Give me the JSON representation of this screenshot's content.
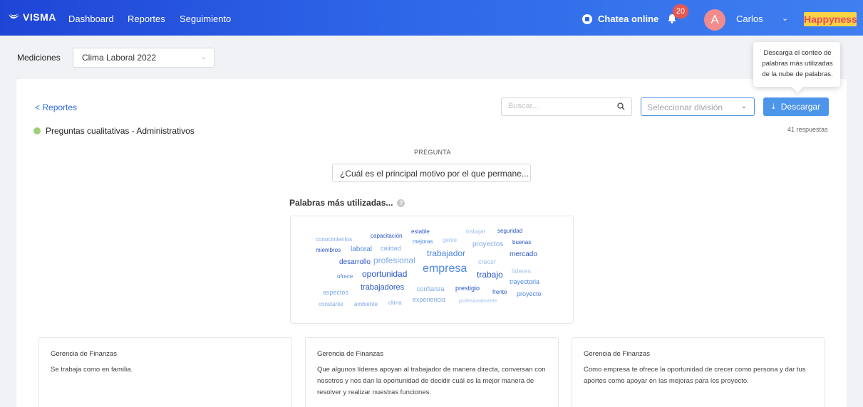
{
  "header": {
    "logo": "VISMA",
    "nav": [
      "Dashboard",
      "Reportes",
      "Seguimiento"
    ],
    "chat_label": "Chatea online",
    "notification_count": "20",
    "avatar_initial": "A",
    "username": "Carlos",
    "brand": "Happyness"
  },
  "mediciones": {
    "label": "Mediciones",
    "selected": "Clima Laboral 2022"
  },
  "toolbar": {
    "back_label": "Reportes",
    "search_placeholder": "Buscar...",
    "division_placeholder": "Seleccionar división",
    "download_label": "Descargar",
    "tooltip": "Descarga el conteo de palabras más utilizadas de la nube de palabras."
  },
  "section": {
    "title": "Preguntas cualitativas - Administrativos",
    "responses": "41 respuestas",
    "pregunta_label": "PREGUNTA",
    "pregunta_selected": "¿Cuál es el principal motivo por el que permane...",
    "palabras_title": "Palabras más utilizadas...",
    "help_icon": "?"
  },
  "word_cloud": [
    {
      "text": "conocimientos",
      "color": "#7fa9e8",
      "size": 8
    },
    {
      "text": "capacitación",
      "color": "#2a55c8",
      "size": 8
    },
    {
      "text": "estable",
      "color": "#2a55c8",
      "size": 8
    },
    {
      "text": "mejoras",
      "color": "#4d86e0",
      "size": 8
    },
    {
      "text": "gente",
      "color": "#9fc0ee",
      "size": 8
    },
    {
      "text": "trabajar",
      "color": "#9fc0ee",
      "size": 8
    },
    {
      "text": "seguridad",
      "color": "#2a55c8",
      "size": 8
    },
    {
      "text": "miembros",
      "color": "#2a55c8",
      "size": 8
    },
    {
      "text": "laboral",
      "color": "#4d86e0",
      "size": 10
    },
    {
      "text": "calidad",
      "color": "#7fa9e8",
      "size": 9
    },
    {
      "text": "proyectos",
      "color": "#7fa9e8",
      "size": 10
    },
    {
      "text": "buenas",
      "color": "#2a55c8",
      "size": 8
    },
    {
      "text": "trabajador",
      "color": "#4d86e0",
      "size": 12
    },
    {
      "text": "mercado",
      "color": "#2a55c8",
      "size": 10
    },
    {
      "text": "desarrollo",
      "color": "#2a55c8",
      "size": 10
    },
    {
      "text": "profesional",
      "color": "#7fa9e8",
      "size": 12
    },
    {
      "text": "crecer",
      "color": "#9fc0ee",
      "size": 9
    },
    {
      "text": "empresa",
      "color": "#4d86e0",
      "size": 16
    },
    {
      "text": "ofrece",
      "color": "#4d86e0",
      "size": 8
    },
    {
      "text": "oportunidad",
      "color": "#2a55c8",
      "size": 12
    },
    {
      "text": "trabajo",
      "color": "#2a55c8",
      "size": 12
    },
    {
      "text": "líderes",
      "color": "#9fc0ee",
      "size": 9
    },
    {
      "text": "trayectoria",
      "color": "#4d86e0",
      "size": 9
    },
    {
      "text": "aspectos",
      "color": "#7fa9e8",
      "size": 9
    },
    {
      "text": "trabajadores",
      "color": "#2a55c8",
      "size": 11
    },
    {
      "text": "confianza",
      "color": "#7fa9e8",
      "size": 9
    },
    {
      "text": "prestigio",
      "color": "#2a55c8",
      "size": 9
    },
    {
      "text": "frente",
      "color": "#2a55c8",
      "size": 8
    },
    {
      "text": "proyecto",
      "color": "#4d86e0",
      "size": 9
    },
    {
      "text": "constante",
      "color": "#7fa9e8",
      "size": 8
    },
    {
      "text": "ambiente",
      "color": "#7fa9e8",
      "size": 8
    },
    {
      "text": "clima",
      "color": "#7fa9e8",
      "size": 8
    },
    {
      "text": "experiencia",
      "color": "#7fa9e8",
      "size": 9
    },
    {
      "text": "profesionalmente",
      "color": "#9fc0ee",
      "size": 7
    }
  ],
  "comments": [
    {
      "title": "Gerencia de Finanzas",
      "text": "Se trabaja como en familia."
    },
    {
      "title": "Gerencia de Finanzas",
      "text": "Que algunos líderes apoyan al trabajador de manera directa, conversan con nosotros y nos dan la oportunidad de decidir cuál es la mejor manera de resolver y realizar nuestras funciones."
    },
    {
      "title": "Gerencia de Finanzas",
      "text": "Como empresa te ofrece la oportunidad de crecer como persona y dar tus aportes como apoyar en las mejoras para los proyecto."
    }
  ],
  "colors": {
    "header_start": "#1f45d6",
    "accent": "#4d95ea",
    "badge": "#e8574f",
    "brand_bg": "#f8d247"
  }
}
